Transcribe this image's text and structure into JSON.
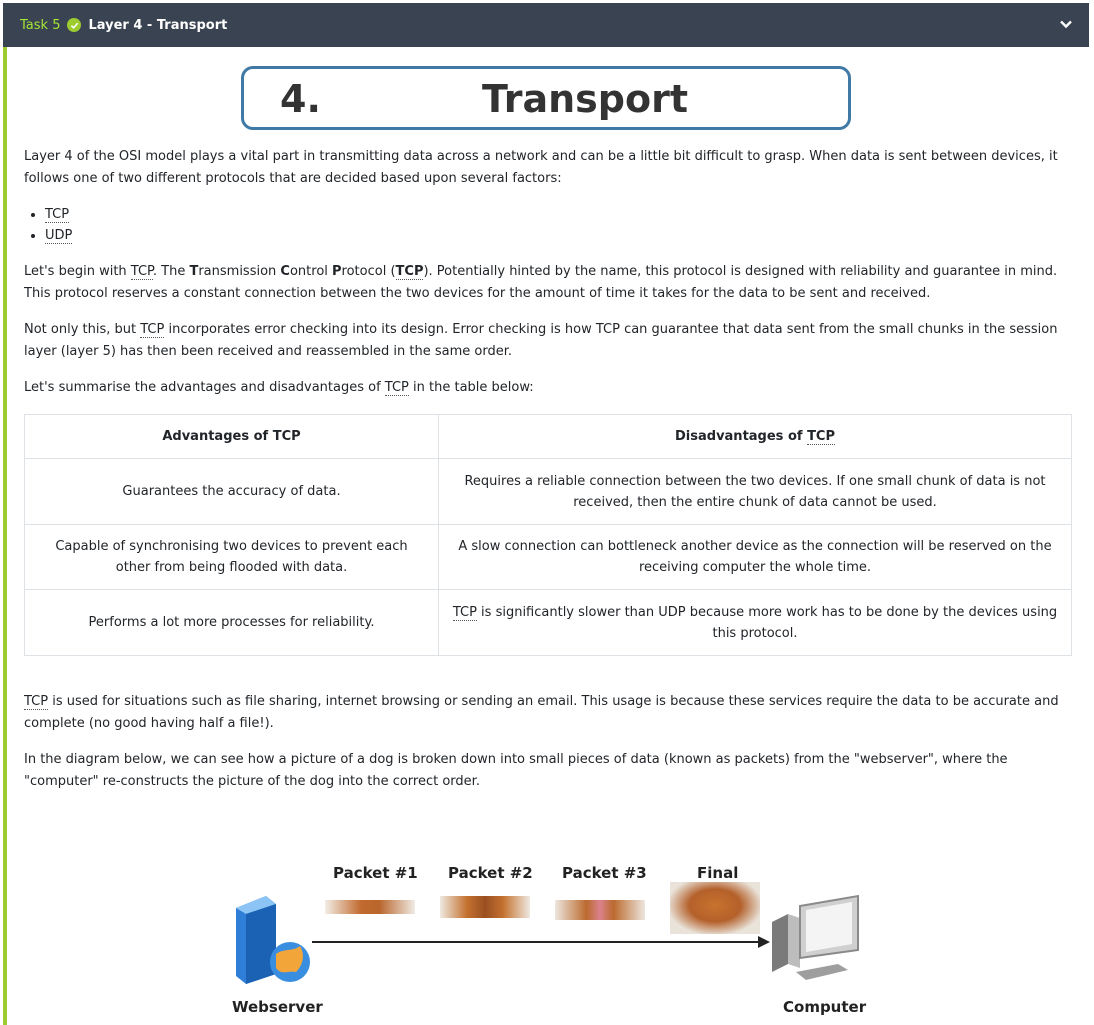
{
  "header": {
    "task_label": "Task 5",
    "title": "Layer 4 - Transport",
    "accent_color": "#9ccc2f"
  },
  "banner": {
    "number": "4.",
    "title": "Transport"
  },
  "intro": "Layer 4 of the OSI model plays a vital part in transmitting data across a network and can be a little bit difficult to grasp. When data is sent between devices, it follows one of two different protocols that are decided based upon several factors:",
  "protocols": [
    "TCP",
    "UDP"
  ],
  "para_tcp_1a": "Let's begin with ",
  "para_tcp_1b": "TCP",
  "para_tcp_1c": ". The ",
  "para_tcp_1d": "ransmission ",
  "para_tcp_1e": "ontrol ",
  "para_tcp_1f": "rotocol (",
  "para_tcp_1g": "). Potentially hinted by the name, this protocol is designed with reliability and guarantee in mind. This protocol reserves a constant connection between the two devices for the amount of time it takes for the data to be sent and received.",
  "letters": {
    "t": "T",
    "c": "C",
    "p": "P"
  },
  "para_tcp_2a": "Not only this, but ",
  "para_tcp_2b": " incorporates error checking into its design. Error checking is how TCP can guarantee that data sent from the small chunks in the session layer (layer 5) has then been received and reassembled in the same order.",
  "para_tcp_3a": "Let's summarise the advantages and disadvantages of ",
  "para_tcp_3b": " in the table below:",
  "table": {
    "adv_header": "Advantages of TCP",
    "dis_header_prefix": "Disadvantages of ",
    "dis_header_abbr": "TCP",
    "rows": [
      {
        "adv": "Guarantees the accuracy of data.",
        "dis": "Requires a reliable connection between the two devices. If one small chunk of data is not received, then the entire chunk of data cannot be used."
      },
      {
        "adv": "Capable of synchronising two devices to prevent each other from being flooded with data.",
        "dis": "A slow connection can bottleneck another device as the connection will be reserved on the receiving computer the whole time."
      },
      {
        "adv": "Performs a lot more processes for reliability.",
        "dis_abbr": "TCP",
        "dis": " is significantly slower than UDP because more work has to be done by the devices using this protocol."
      }
    ]
  },
  "para_usage_abbr": "TCP",
  "para_usage": " is used for situations such as file sharing, internet browsing or sending an email. This usage is because these services require the data to be accurate and complete (no good having half a file!).",
  "para_diagram": "In the diagram below, we can see how a picture of a dog is broken down into small pieces of data (known as packets) from the \"webserver\", where the \"computer\" re-constructs the picture of the dog into the correct order.",
  "diagram": {
    "packets": [
      "Packet #1",
      "Packet #2",
      "Packet #3",
      "Final"
    ],
    "source_label": "Webserver",
    "dest_label": "Computer"
  }
}
